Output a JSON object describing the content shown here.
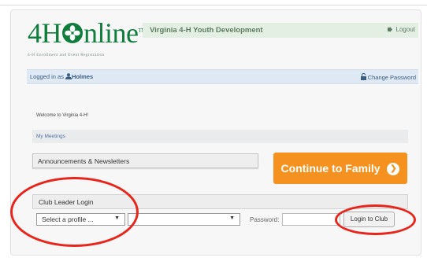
{
  "branding": {
    "logo_text_left": "4H",
    "logo_text_right": "nline",
    "logo_tm": "TM",
    "logo_subtitle": "4-H Enrollment and Event Registration",
    "site_title": "Virginia 4-H Youth Development"
  },
  "header": {
    "logout_label": "Logout"
  },
  "user_bar": {
    "logged_in_prefix": "Logged in as",
    "username": "Holmes",
    "change_password_label": "Change Password"
  },
  "main": {
    "welcome_text": "Welcome to Virginia 4-H!",
    "my_meetings_label": "My Meetings",
    "announcements_label": "Announcements & Newsletters",
    "continue_button_label": "Continue to Family",
    "continue_arrow": "❯"
  },
  "club_login": {
    "section_label": "Club Leader Login",
    "profile_select_value": "Select a profile ...",
    "club_select_value": "",
    "caret": "▼",
    "password_label": "Password:",
    "password_value": "",
    "login_button_label": "Login to Club"
  },
  "colors": {
    "logo_green": "#0f7d3b",
    "header_bar": "#e3efe3",
    "user_bar": "#dfe9f4",
    "continue_orange": "#f5921f",
    "highlight_red": "#e8251b"
  },
  "icons": {
    "logout": "logout-icon",
    "user": "user-icon",
    "lock": "lock-icon",
    "clover": "clover-icon"
  }
}
